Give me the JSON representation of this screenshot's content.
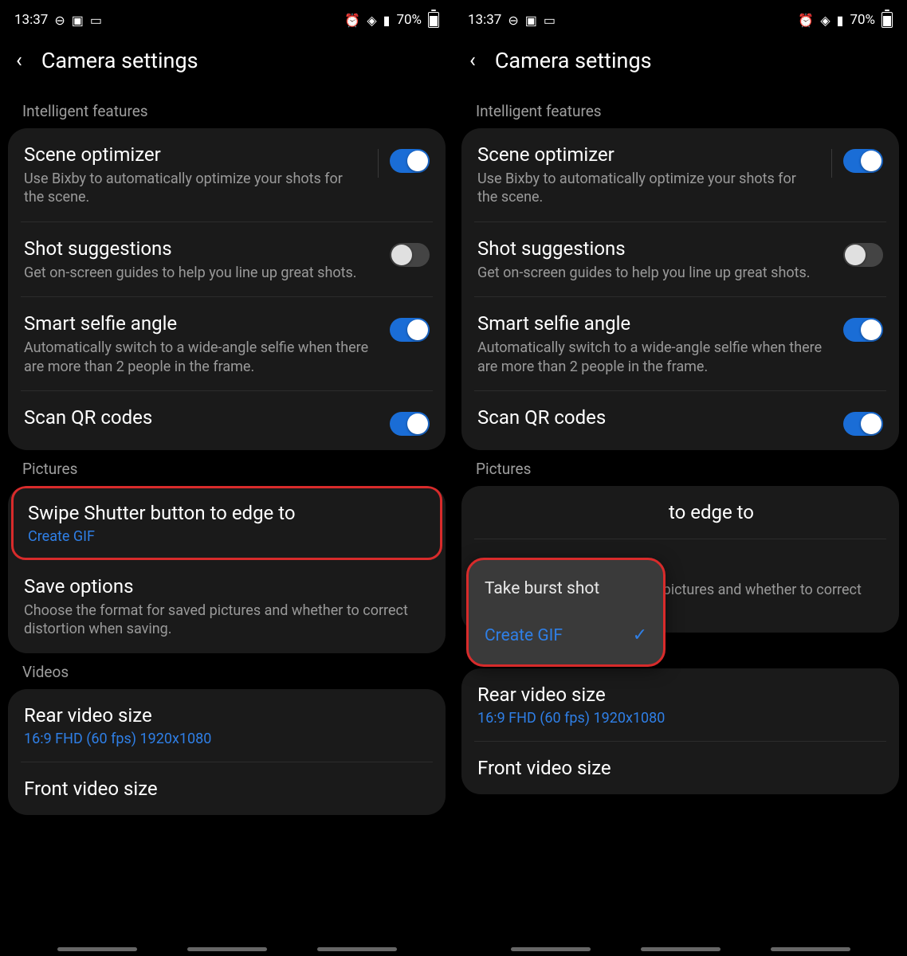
{
  "status": {
    "time": "13:37",
    "battery": "70%"
  },
  "header": {
    "title": "Camera settings"
  },
  "sections": {
    "intelligent": "Intelligent features",
    "pictures": "Pictures",
    "videos": "Videos"
  },
  "items": {
    "scene_optimizer": {
      "title": "Scene optimizer",
      "desc": "Use Bixby to automatically optimize your shots for the scene.",
      "on": true
    },
    "shot_suggestions": {
      "title": "Shot suggestions",
      "desc": "Get on-screen guides to help you line up great shots.",
      "on": false
    },
    "smart_selfie": {
      "title": "Smart selfie angle",
      "desc": "Automatically switch to a wide-angle selfie when there are more than 2 people in the frame.",
      "on": true
    },
    "scan_qr": {
      "title": "Scan QR codes",
      "on": true
    },
    "swipe_shutter": {
      "title": "Swipe Shutter button to edge to",
      "value": "Create GIF"
    },
    "swipe_shutter_partial": {
      "title_fragment": "to edge to"
    },
    "save_options": {
      "title": "Save options",
      "desc": "Choose the format for saved pictures and whether to correct distortion when saving."
    },
    "rear_video": {
      "title": "Rear video size",
      "value": "16:9 FHD (60 fps) 1920x1080"
    },
    "front_video": {
      "title": "Front video size"
    }
  },
  "popup": {
    "option1": "Take burst shot",
    "option2": "Create GIF"
  }
}
